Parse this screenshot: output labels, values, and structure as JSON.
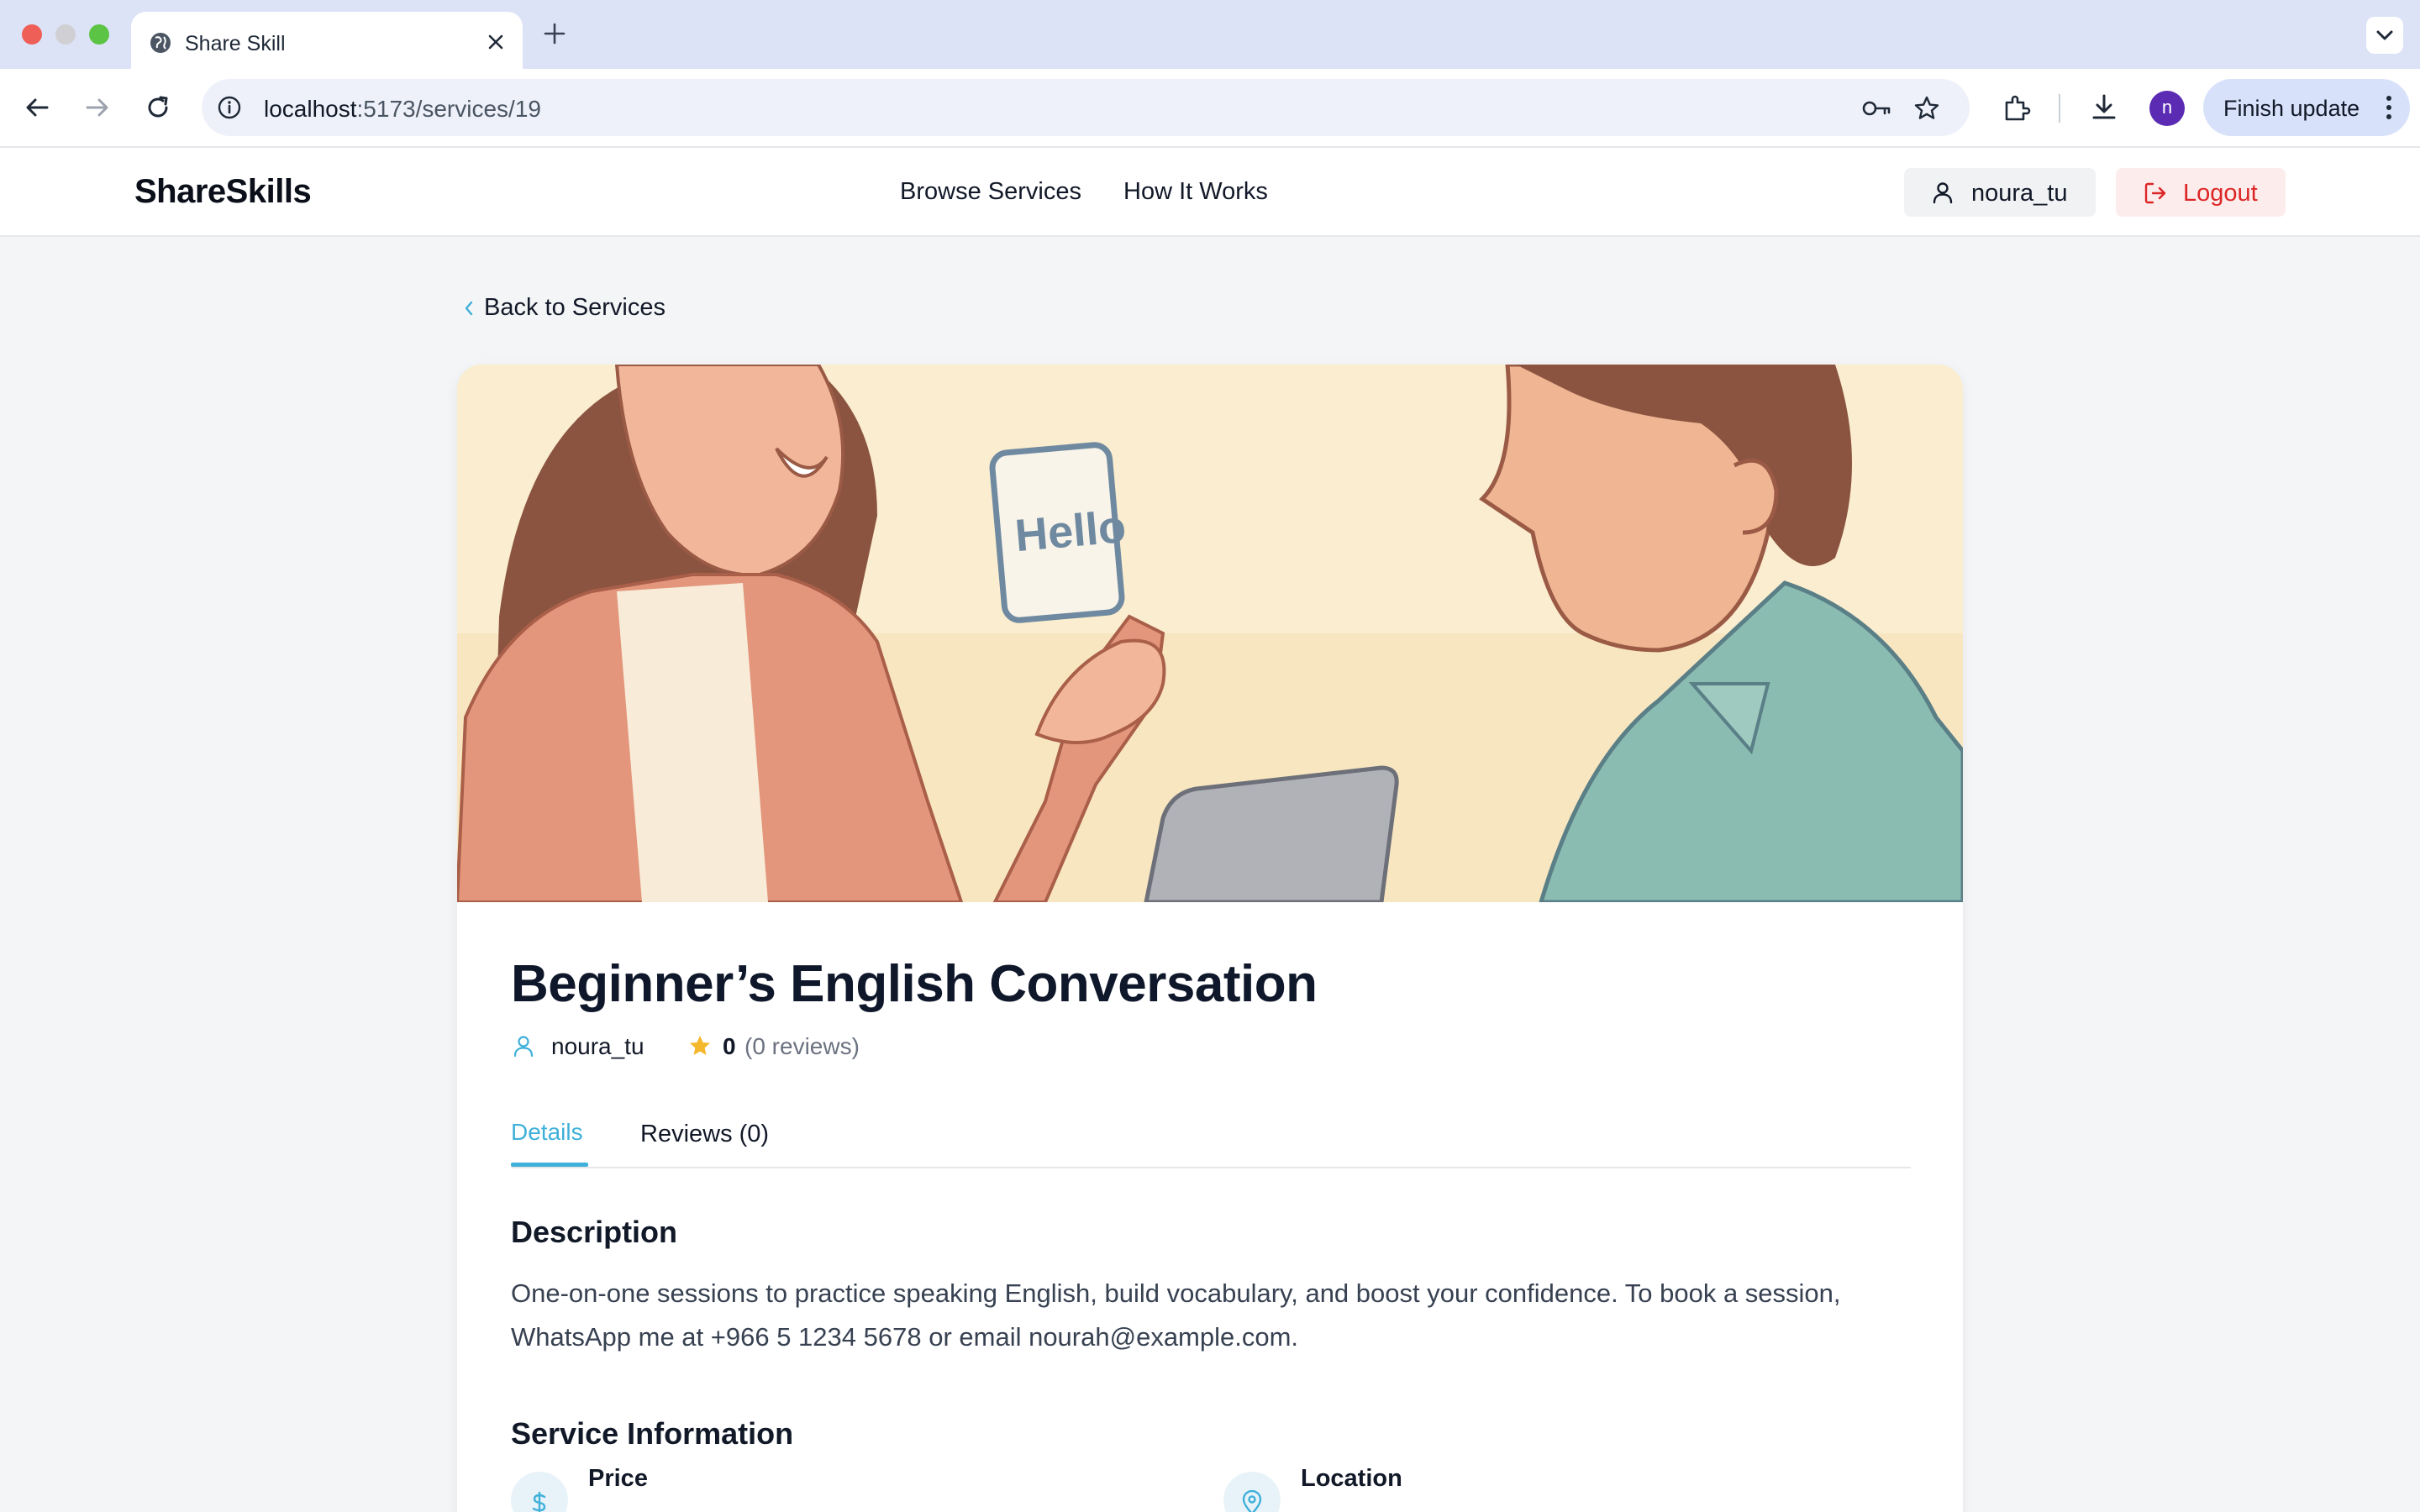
{
  "browser": {
    "tab_title": "Share Skill",
    "url_host": "localhost",
    "url_rest": ":5173/services/19",
    "profile_initial": "n",
    "update_label": "Finish update"
  },
  "site": {
    "logo": "ShareSkills",
    "nav": [
      "Browse Services",
      "How It Works"
    ],
    "username": "noura_tu",
    "logout_label": "Logout"
  },
  "page": {
    "back_label": "Back to Services",
    "hero_sign": "Hello",
    "title": "Beginner’s English Conversation",
    "provider": "noura_tu",
    "rating": "0",
    "reviews_count_text": "(0 reviews)",
    "tabs": {
      "details": "Details",
      "reviews": "Reviews (0)"
    },
    "description_heading": "Description",
    "description": "One-on-one sessions to practice speaking English, build vocabulary, and boost your confidence. To book a session, WhatsApp me at +966 5 1234 5678 or email nourah@example.com.",
    "info_heading": "Service Information",
    "info_items": [
      "Price",
      "Location"
    ]
  },
  "colors": {
    "accent": "#3fb0d9",
    "logout": "#dc2626",
    "star": "#f5b72b"
  }
}
